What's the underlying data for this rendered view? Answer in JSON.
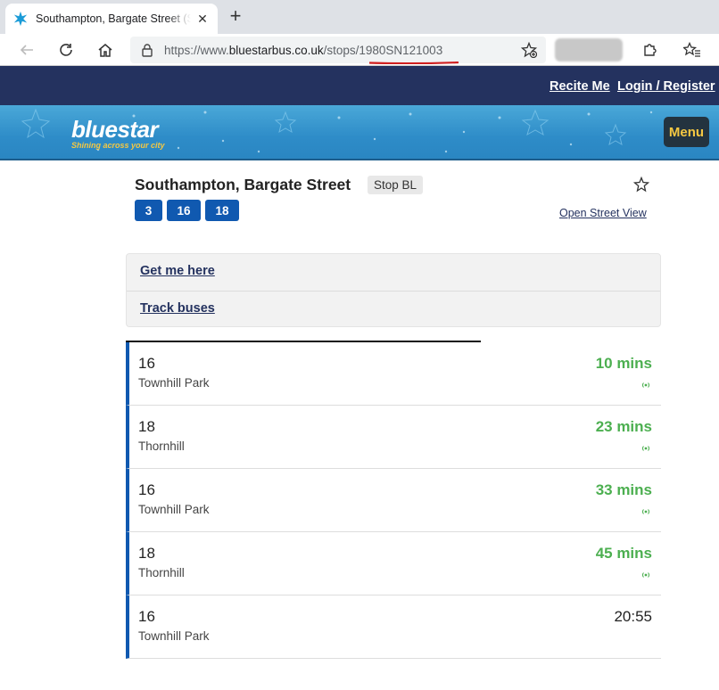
{
  "browser": {
    "tab_title": "Southampton, Bargate Street (Sto",
    "url_prefix": "https://www.",
    "url_host": "bluestarbus.co.uk",
    "url_path": "/stops/1980SN121003"
  },
  "site": {
    "recite_label": "Recite Me",
    "login_label": "Login / Register",
    "logo_text": "bluestar",
    "logo_tagline": "Shining across your city",
    "menu_label": "Menu",
    "colors": {
      "navy": "#24325f",
      "route_blue": "#1059b0",
      "live_green": "#4caf50",
      "menu_yellow": "#f5c842"
    }
  },
  "stop": {
    "name": "Southampton, Bargate Street",
    "code": "Stop BL",
    "routes": [
      "3",
      "16",
      "18"
    ],
    "street_view_label": "Open Street View",
    "actions": [
      "Get me here",
      "Track buses"
    ]
  },
  "departures": [
    {
      "route": "16",
      "destination": "Townhill Park",
      "time": "10 mins",
      "live": true
    },
    {
      "route": "18",
      "destination": "Thornhill",
      "time": "23 mins",
      "live": true
    },
    {
      "route": "16",
      "destination": "Townhill Park",
      "time": "33 mins",
      "live": true
    },
    {
      "route": "18",
      "destination": "Thornhill",
      "time": "45 mins",
      "live": true
    },
    {
      "route": "16",
      "destination": "Townhill Park",
      "time": "20:55",
      "live": false
    }
  ]
}
